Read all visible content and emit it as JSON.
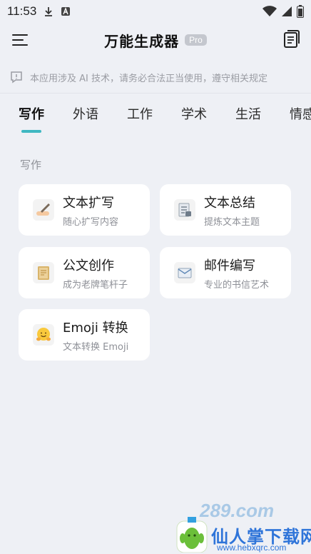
{
  "status": {
    "time": "11:53",
    "left_icons": [
      "download-icon",
      "a-box-icon"
    ],
    "right_icons": [
      "wifi-icon",
      "signal-icon",
      "battery-icon"
    ]
  },
  "header": {
    "title": "万能生成器",
    "badge": "Pro"
  },
  "notice": {
    "text": "本应用涉及 AI 技术，请务必合法正当使用，遵守相关规定"
  },
  "tabs": [
    {
      "label": "写作",
      "active": true
    },
    {
      "label": "外语",
      "active": false
    },
    {
      "label": "工作",
      "active": false
    },
    {
      "label": "学术",
      "active": false
    },
    {
      "label": "生活",
      "active": false
    },
    {
      "label": "情感",
      "active": false
    }
  ],
  "section": {
    "title": "写作"
  },
  "tools": [
    {
      "name": "文本扩写",
      "desc": "随心扩写内容",
      "icon": "writing-hand-icon"
    },
    {
      "name": "文本总结",
      "desc": "提炼文本主题",
      "icon": "document-icon"
    },
    {
      "name": "公文创作",
      "desc": "成为老牌笔杆子",
      "icon": "folder-icon"
    },
    {
      "name": "邮件编写",
      "desc": "专业的书信艺术",
      "icon": "envelope-icon"
    },
    {
      "name": "Emoji 转换",
      "desc": "文本转换 Emoji",
      "icon": "hugging-face-icon"
    }
  ],
  "watermark": {
    "logo": "289.com",
    "cn_text": "仙人掌下载网",
    "url": "www.hebxqrc.com"
  },
  "colors": {
    "background": "#eef0f5",
    "accent": "#3fb8c2",
    "card": "#ffffff"
  }
}
